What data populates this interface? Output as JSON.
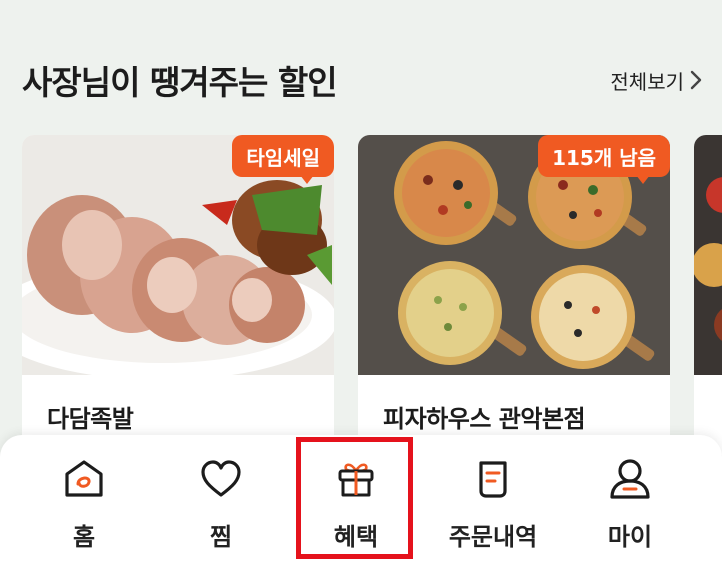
{
  "section": {
    "title": "사장님이 땡겨주는 할인",
    "see_all": "전체보기"
  },
  "cards": [
    {
      "name": "다담족발",
      "badge": "타임세일"
    },
    {
      "name": "피자하우스 관악본점",
      "badge": "115개 남음"
    },
    {
      "name": "",
      "badge": ""
    }
  ],
  "tabs": [
    {
      "label": "홈",
      "icon": "home-icon"
    },
    {
      "label": "찜",
      "icon": "heart-icon"
    },
    {
      "label": "혜택",
      "icon": "gift-icon"
    },
    {
      "label": "주문내역",
      "icon": "receipt-icon"
    },
    {
      "label": "마이",
      "icon": "person-icon"
    }
  ],
  "colors": {
    "accent": "#f05a22",
    "highlight_box": "#e5121c",
    "background": "#eef2ee"
  }
}
